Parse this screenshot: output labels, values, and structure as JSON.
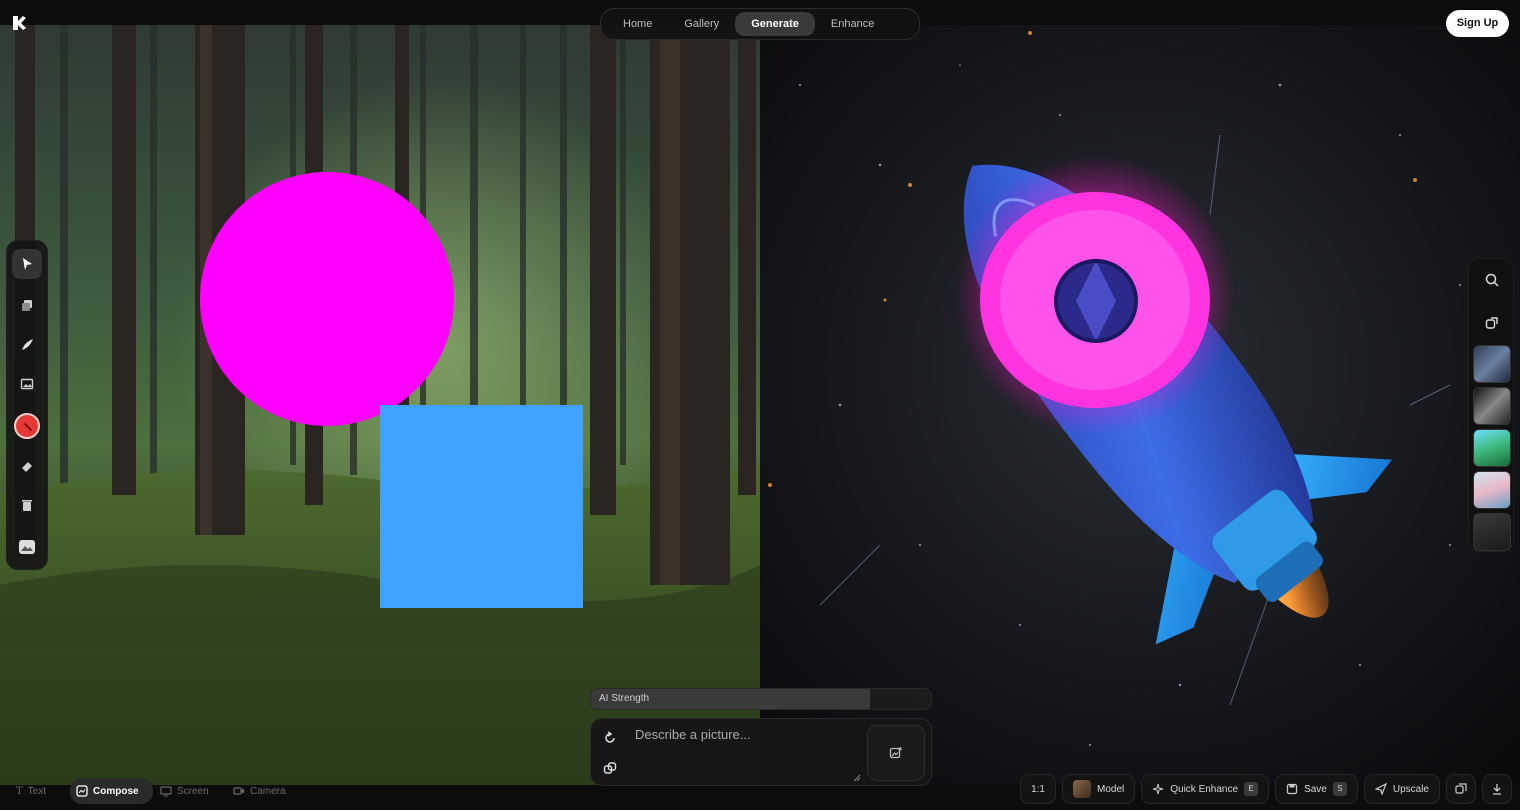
{
  "nav": {
    "tabs": [
      {
        "label": "Home"
      },
      {
        "label": "Gallery"
      },
      {
        "label": "Generate"
      },
      {
        "label": "Enhance"
      }
    ],
    "active": "Generate"
  },
  "header": {
    "signup_label": "Sign Up"
  },
  "canvas": {
    "shapes": [
      {
        "kind": "circle",
        "color": "#ff00ff"
      },
      {
        "kind": "square",
        "color": "#3fa2ff"
      }
    ]
  },
  "toolbar": {
    "tools": [
      "select-icon",
      "layers-icon",
      "pen-icon",
      "image-icon",
      "color-picker-icon",
      "eraser-icon",
      "trash-icon",
      "background-icon"
    ],
    "active_tool": "select-icon",
    "color": "#e53935"
  },
  "prompt": {
    "strength_label": "AI Strength",
    "strength_level": 0.82,
    "placeholder": "Describe a picture..."
  },
  "modes": [
    {
      "label": "Text"
    },
    {
      "label": "Compose"
    },
    {
      "label": "Screen"
    },
    {
      "label": "Camera"
    }
  ],
  "active_mode": "Compose",
  "actions": {
    "ratio": "1:1",
    "model": "Model",
    "quick_enhance": "Quick Enhance",
    "quick_enhance_key": "E",
    "save": "Save",
    "save_key": "S",
    "upscale": "Upscale"
  }
}
